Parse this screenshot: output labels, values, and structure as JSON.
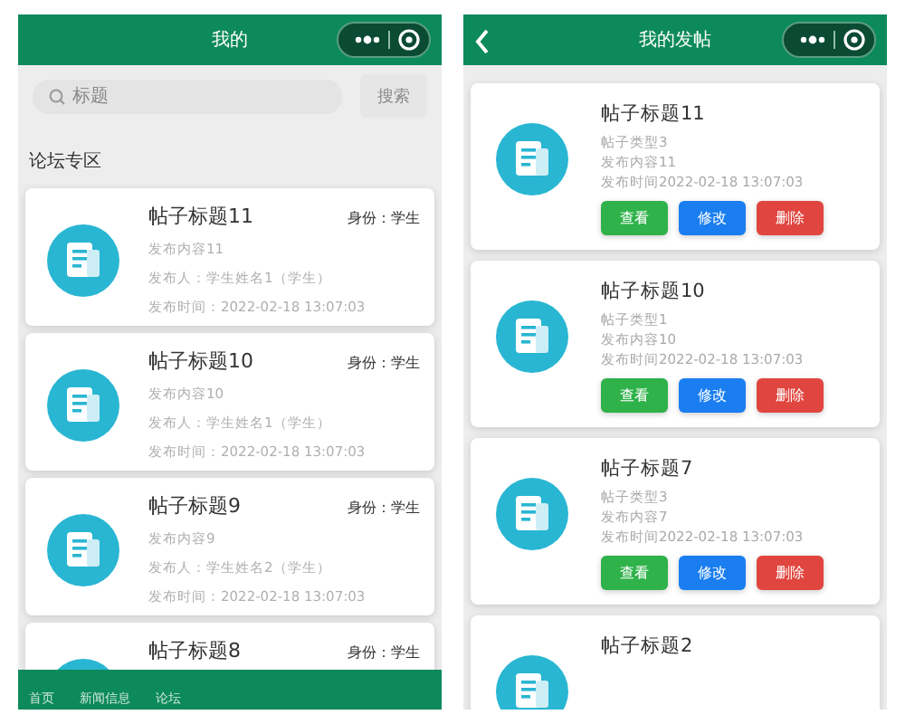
{
  "left_screen": {
    "nav_title": "我的",
    "search": {
      "placeholder": "标题",
      "button": "搜索"
    },
    "section_title": "论坛专区",
    "posts": [
      {
        "title": "帖子标题11",
        "identity": "身份：学生",
        "content": "发布内容11",
        "author": "发布人：学生姓名1（学生）",
        "time": "发布时间：2022-02-18 13:07:03"
      },
      {
        "title": "帖子标题10",
        "identity": "身份：学生",
        "content": "发布内容10",
        "author": "发布人：学生姓名1（学生）",
        "time": "发布时间：2022-02-18 13:07:03"
      },
      {
        "title": "帖子标题9",
        "identity": "身份：学生",
        "content": "发布内容9",
        "author": "发布人：学生姓名2（学生）",
        "time": "发布时间：2022-02-18 13:07:03"
      },
      {
        "title": "帖子标题8",
        "identity": "身份：学生"
      }
    ],
    "tab_bar": [
      {
        "label": "首页"
      },
      {
        "label": "新闻信息"
      },
      {
        "label": "论坛"
      }
    ]
  },
  "right_screen": {
    "nav_title": "我的发帖",
    "posts": [
      {
        "title": "帖子标题11",
        "type": "帖子类型3",
        "content": "发布内容11",
        "time": "发布时间2022-02-18 13:07:03",
        "actions": [
          {
            "label": "查看",
            "kind": "view"
          },
          {
            "label": "修改",
            "kind": "edit"
          },
          {
            "label": "删除",
            "kind": "delete"
          }
        ]
      },
      {
        "title": "帖子标题10",
        "type": "帖子类型1",
        "content": "发布内容10",
        "time": "发布时间2022-02-18 13:07:03",
        "actions": [
          {
            "label": "查看",
            "kind": "view"
          },
          {
            "label": "修改",
            "kind": "edit"
          },
          {
            "label": "删除",
            "kind": "delete"
          }
        ]
      },
      {
        "title": "帖子标题7",
        "type": "帖子类型3",
        "content": "发布内容7",
        "time": "发布时间2022-02-18 13:07:03",
        "actions": [
          {
            "label": "查看",
            "kind": "view"
          },
          {
            "label": "修改",
            "kind": "edit"
          },
          {
            "label": "删除",
            "kind": "delete"
          }
        ]
      },
      {
        "title": "帖子标题2"
      }
    ]
  }
}
